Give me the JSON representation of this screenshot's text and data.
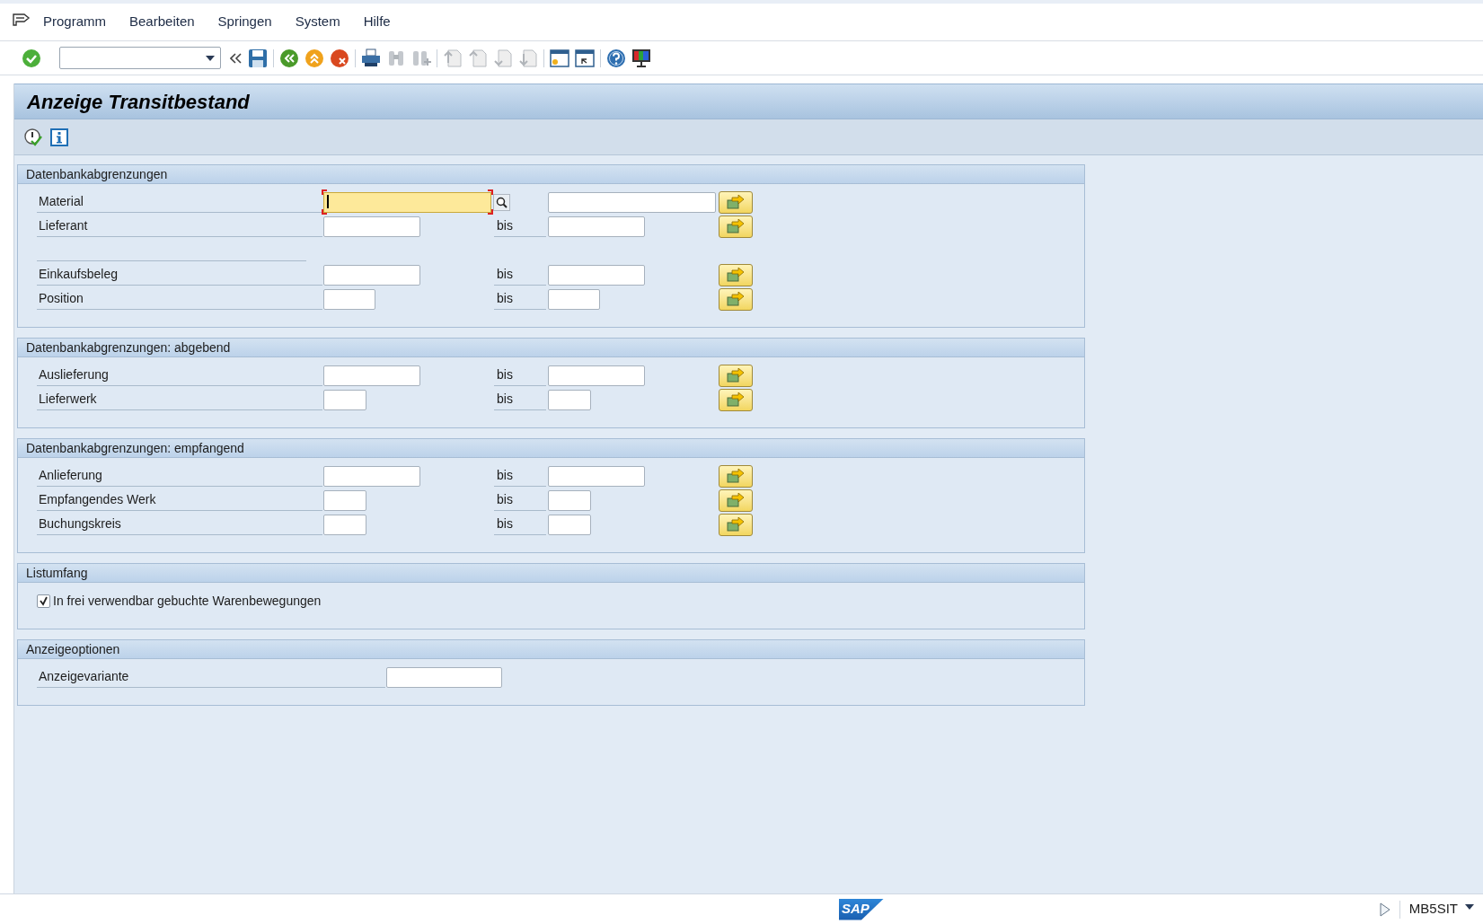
{
  "menu": [
    "Programm",
    "Bearbeiten",
    "Springen",
    "System",
    "Hilfe"
  ],
  "title": "Anzeige Transitbestand",
  "groups": [
    {
      "title": "Datenbankabgrenzungen",
      "rows": [
        {
          "kind": "range",
          "label": "Material",
          "focused": true
        },
        {
          "kind": "range",
          "label": "Lieferant",
          "to_label": "bis",
          "focused": false
        },
        {
          "kind": "separator"
        },
        {
          "kind": "range",
          "label": "Einkaufsbeleg",
          "to_label": "bis",
          "focused": false
        },
        {
          "kind": "range",
          "label": "Position",
          "to_label": "bis",
          "focused": false
        }
      ]
    },
    {
      "title": "Datenbankabgrenzungen: abgebend",
      "rows": [
        {
          "kind": "range",
          "label": "Auslieferung",
          "to_label": "bis",
          "focused": false
        },
        {
          "kind": "range",
          "label": "Lieferwerk",
          "to_label": "bis",
          "focused": false
        }
      ]
    },
    {
      "title": "Datenbankabgrenzungen: empfangend",
      "rows": [
        {
          "kind": "range",
          "label": "Anlieferung",
          "to_label": "bis",
          "focused": false
        },
        {
          "kind": "range",
          "label": "Empfangendes Werk",
          "to_label": "bis",
          "focused": false
        },
        {
          "kind": "range",
          "label": "Buchungskreis",
          "to_label": "bis",
          "focused": false
        }
      ]
    },
    {
      "title": "Listumfang",
      "rows": [
        {
          "kind": "checkbox",
          "label": "In frei verwendbar gebuchte Warenbewegungen",
          "checked": true
        }
      ]
    },
    {
      "title": "Anzeigeoptionen",
      "rows": [
        {
          "kind": "single",
          "label": "Anzeigevariante"
        }
      ]
    }
  ],
  "status": {
    "logo": "SAP",
    "transaction": "MB5SIT"
  }
}
